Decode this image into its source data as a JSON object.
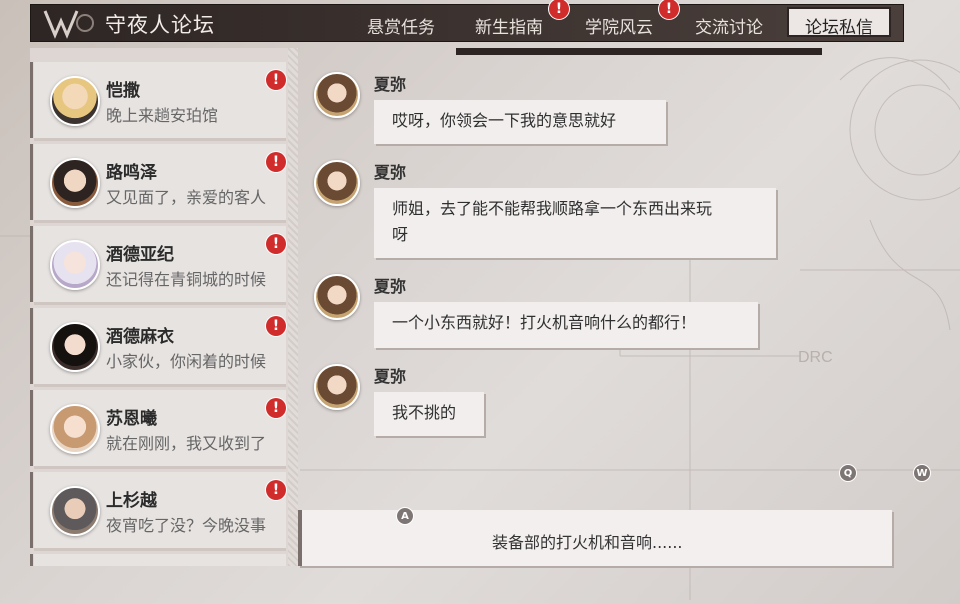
{
  "header": {
    "title": "守夜人论坛",
    "tabs": [
      {
        "label": "悬赏任务",
        "badge": ""
      },
      {
        "label": "新生指南",
        "badge": "!"
      },
      {
        "label": "学院风云",
        "badge": "!"
      },
      {
        "label": "交流讨论",
        "badge": ""
      },
      {
        "label": "论坛私信",
        "badge": "",
        "active": true
      }
    ]
  },
  "conversations": [
    {
      "name": "恺撒",
      "preview": "晚上来趟安珀馆",
      "badge": "!"
    },
    {
      "name": "路鸣泽",
      "preview": "又见面了，亲爱的客人",
      "badge": "!"
    },
    {
      "name": "酒德亚纪",
      "preview": "还记得在青铜城的时候",
      "badge": "!"
    },
    {
      "name": "酒德麻衣",
      "preview": "小家伙，你闲着的时候",
      "badge": "!"
    },
    {
      "name": "苏恩曦",
      "preview": "就在刚刚，我又收到了",
      "badge": "!"
    },
    {
      "name": "上杉越",
      "preview": "夜宵吃了没？今晚没事",
      "badge": "!"
    }
  ],
  "messages": [
    {
      "sender": "夏弥",
      "lines": [
        "哎呀，你领会一下我的意思就好"
      ]
    },
    {
      "sender": "夏弥",
      "lines": [
        "师姐，去了能不能帮我顺路拿一个东西出来玩",
        "呀"
      ]
    },
    {
      "sender": "夏弥",
      "lines": [
        "一个小东西就好！打火机音响什么的都行！"
      ]
    },
    {
      "sender": "夏弥",
      "lines": [
        "我不挑的"
      ]
    }
  ],
  "reply": {
    "text": "装备部的打火机和音响......",
    "key": "A"
  },
  "key_hints": {
    "q": "Q",
    "w": "W"
  },
  "bg_marks": {
    "drc": "DRC"
  },
  "colors": {
    "badge": "#d02c2c",
    "header_bg": "#2e2624",
    "panel": "#e7e3e1"
  }
}
